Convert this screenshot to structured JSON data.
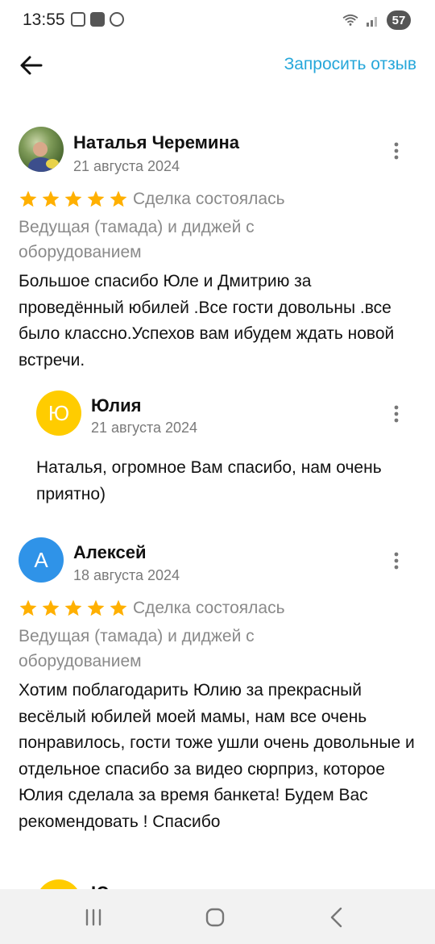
{
  "status_bar": {
    "time": "13:55",
    "battery": "57",
    "left_icons": [
      "screenshot-icon",
      "vk-icon",
      "go-icon"
    ]
  },
  "header": {
    "request_review": "Запросить отзыв"
  },
  "reviews": [
    {
      "author": "Наталья Черемина",
      "date": "21 августа 2024",
      "rating": 5,
      "deal_status": "Сделка состоялась",
      "service": "Ведущая (тамада) и диджей с оборудованием",
      "text": "Большое спасибо Юле и Дмитрию за проведённый юбилей .Все гости довольны .все было классно.Успехов вам ибудем ждать новой встречи.",
      "reply": {
        "avatar_letter": "Ю",
        "author": "Юлия",
        "date": "21 августа 2024",
        "text": "Наталья, огромное Вам спасибо,  нам очень приятно)"
      }
    },
    {
      "avatar_letter": "А",
      "author": "Алексей",
      "date": "18 августа 2024",
      "rating": 5,
      "deal_status": "Сделка состоялась",
      "service": "Ведущая (тамада) и диджей с оборудованием",
      "text": "Хотим поблагодарить Юлию за прекрасный весёлый юбилей моей мамы, нам все очень понравилось, гости тоже ушли очень довольные и отдельное спасибо за видео сюрприз,  которое Юлия сделала за время банкета! Будем Вас рекомендовать ! Спасибо",
      "reply": {
        "author": "Юлия"
      }
    }
  ],
  "colors": {
    "accent": "#26a7da",
    "star": "#ffb000",
    "reply_avatar": "#ffcc00",
    "avatar_a": "#2f93e8",
    "muted_text": "#8a8a8a"
  }
}
